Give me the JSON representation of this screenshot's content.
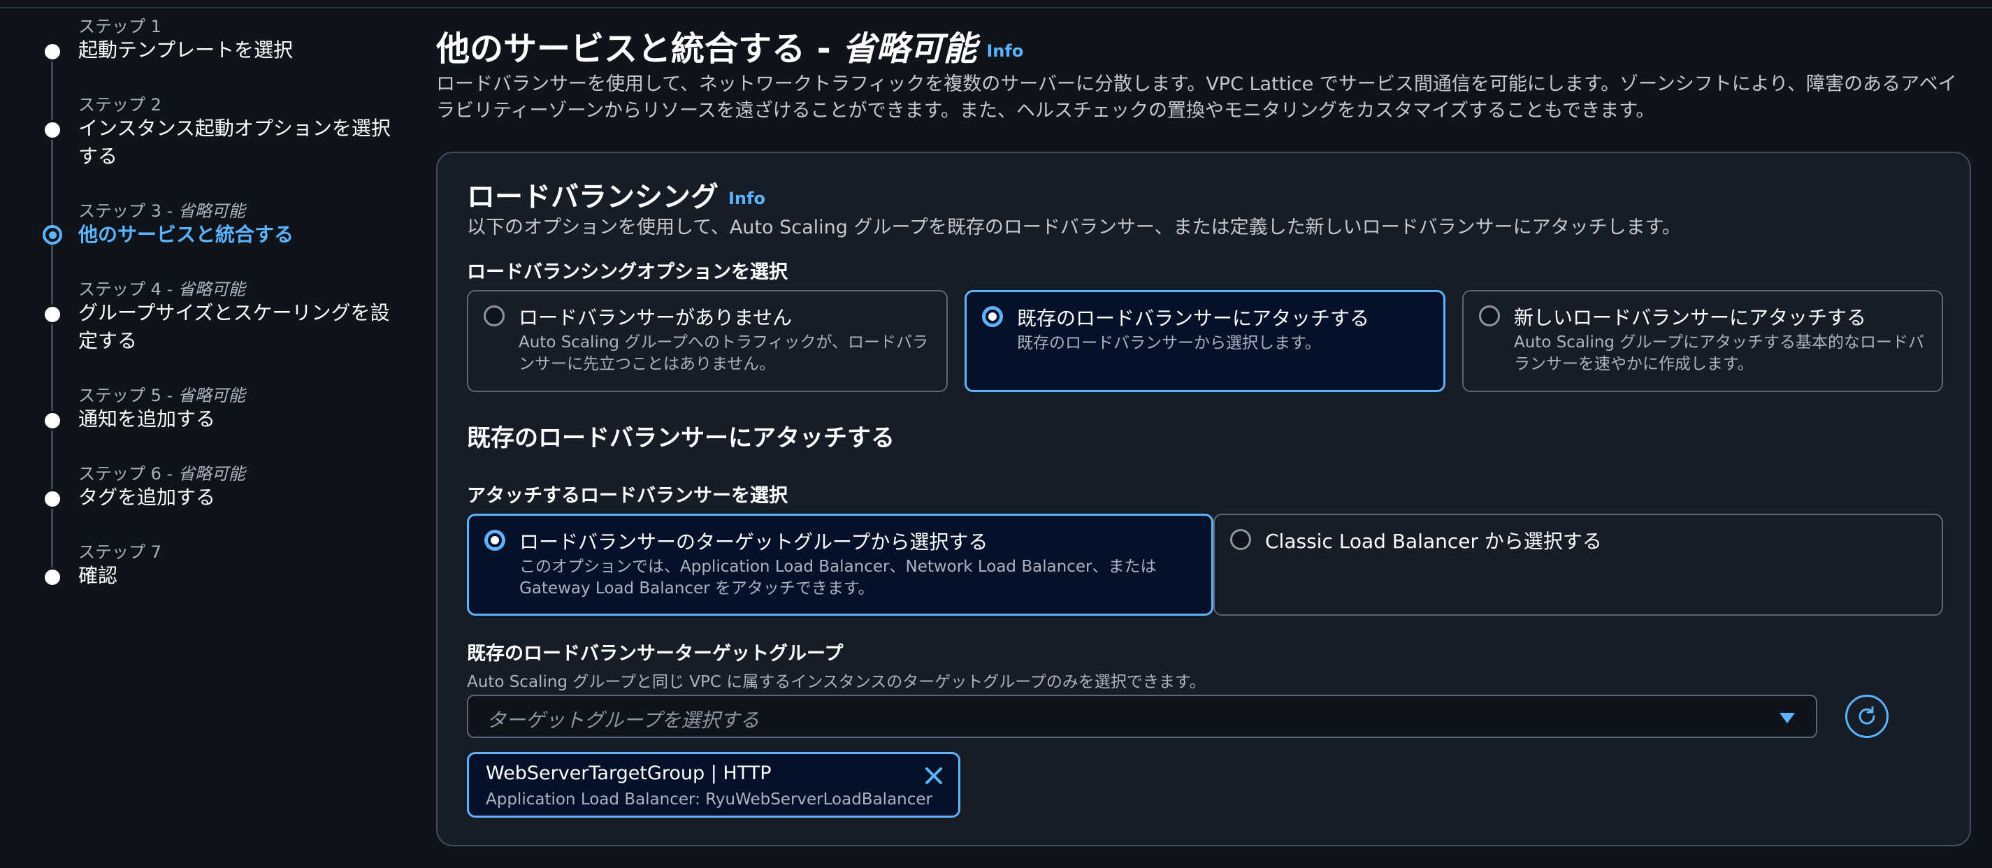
{
  "steps": [
    {
      "num": "ステップ 1",
      "optional": "",
      "title": "起動テンプレートを選択"
    },
    {
      "num": "ステップ 2",
      "optional": "",
      "title": "インスタンス起動オプションを選択する"
    },
    {
      "num": "ステップ 3 - ",
      "optional": "省略可能",
      "title": "他のサービスと統合する"
    },
    {
      "num": "ステップ 4 - ",
      "optional": "省略可能",
      "title": "グループサイズとスケーリングを設定する"
    },
    {
      "num": "ステップ 5 - ",
      "optional": "省略可能",
      "title": "通知を追加する"
    },
    {
      "num": "ステップ 6 - ",
      "optional": "省略可能",
      "title": "タグを追加する"
    },
    {
      "num": "ステップ 7",
      "optional": "",
      "title": "確認"
    }
  ],
  "page": {
    "title": "他のサービスと統合する - ",
    "title_optional": "省略可能",
    "info": "Info",
    "description": "ロードバランサーを使用して、ネットワークトラフィックを複数のサーバーに分散します。VPC Lattice でサービス間通信を可能にします。ゾーンシフトにより、障害のあるアベイラビリティーゾーンからリソースを遠ざけることができます。また、ヘルスチェックの置換やモニタリングをカスタマイズすることもできます。"
  },
  "lb": {
    "title": "ロードバランシング",
    "info": "Info",
    "description": "以下のオプションを使用して、Auto Scaling グループを既存のロードバランサー、または定義した新しいロードバランサーにアタッチします。",
    "options_label": "ロードバランシングオプションを選択",
    "options": [
      {
        "title": "ロードバランサーがありません",
        "desc": "Auto Scaling グループへのトラフィックが、ロードバランサーに先立つことはありません。"
      },
      {
        "title": "既存のロードバランサーにアタッチする",
        "desc": "既存のロードバランサーから選択します。"
      },
      {
        "title": "新しいロードバランサーにアタッチする",
        "desc": "Auto Scaling グループにアタッチする基本的なロードバランサーを速やかに作成します。"
      }
    ],
    "selected_option": 1
  },
  "attach": {
    "title": "既存のロードバランサーにアタッチする",
    "choose_label": "アタッチするロードバランサーを選択",
    "choices": [
      {
        "title": "ロードバランサーのターゲットグループから選択する",
        "desc": "このオプションでは、Application Load Balancer、Network Load Balancer、または Gateway Load Balancer をアタッチできます。"
      },
      {
        "title": "Classic Load Balancer から選択する",
        "desc": ""
      }
    ],
    "selected_choice": 0,
    "tg_label": "既存のロードバランサーターゲットグループ",
    "tg_hint": "Auto Scaling グループと同じ VPC に属するインスタンスのターゲットグループのみを選択できます。",
    "tg_placeholder": "ターゲットグループを選択する",
    "token": {
      "title": "WebServerTargetGroup | HTTP",
      "subtitle": "Application Load Balancer: RyuWebServerLoadBalancer"
    }
  },
  "colors": {
    "background": "#0f141a",
    "panel": "#161d26",
    "accent": "#5eb3ff",
    "selected_bg": "#041128"
  }
}
